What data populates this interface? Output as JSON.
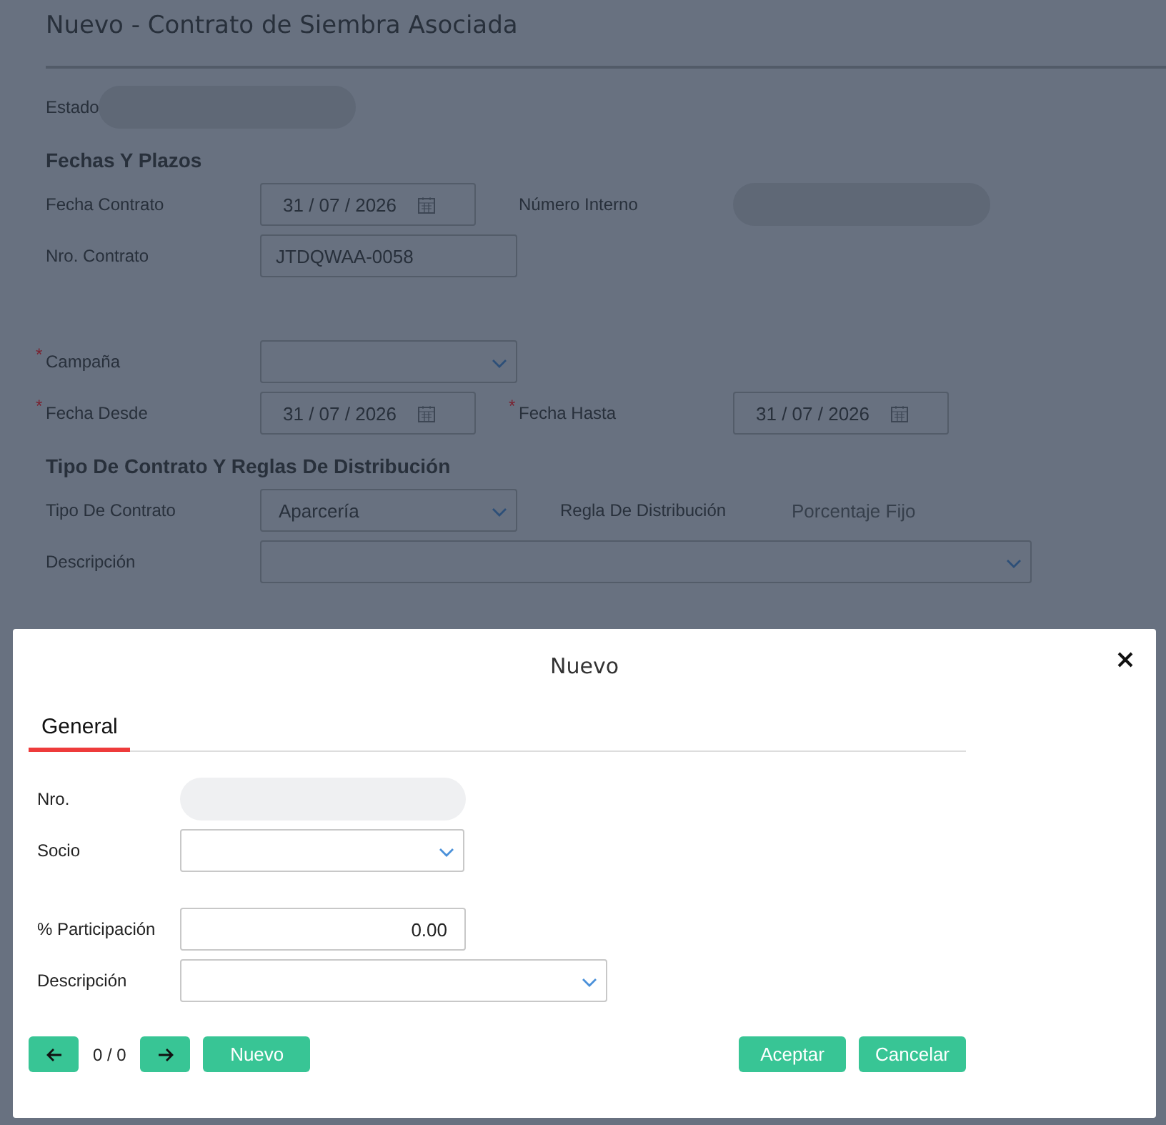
{
  "page": {
    "title": "Nuevo - Contrato de Siembra Asociada",
    "estado": {
      "label": "Estado"
    },
    "sections": [
      {
        "heading": "Fechas Y Plazos",
        "rows": [
          [
            {
              "kind": "date",
              "label": "Fecha Contrato",
              "value": "31 / 07 / 2026"
            },
            {
              "kind": "readonly",
              "label": "Número Interno"
            }
          ],
          [
            {
              "kind": "text",
              "label": "Nro. Contrato",
              "value": "JTDQWAA-0058"
            }
          ]
        ],
        "after_gap": [
          [
            {
              "kind": "select",
              "label": "Campaña",
              "required_mark": "*"
            }
          ],
          [
            {
              "kind": "date",
              "label": "Fecha Desde",
              "required_mark": "*",
              "value": "31 / 07 / 2026"
            },
            {
              "kind": "date",
              "label": "Fecha Hasta",
              "required_mark": "*",
              "value": "31 / 07 / 2026"
            }
          ]
        ]
      },
      {
        "heading": "Tipo De Contrato Y Reglas De Distribución",
        "rows": [
          [
            {
              "kind": "select",
              "label": "Tipo De Contrato",
              "value": "Aparcería"
            },
            {
              "kind": "plain",
              "label": "Regla De Distribución",
              "value": "Porcentaje Fijo"
            }
          ],
          [
            {
              "kind": "wideselect",
              "label": "Descripción"
            }
          ]
        ]
      }
    ]
  },
  "dialog": {
    "title": "Nuevo",
    "tabs": [
      {
        "label": "General",
        "selected": true
      }
    ],
    "fields": [
      {
        "kind": "readonly",
        "label": "Nro."
      },
      {
        "kind": "select",
        "label": "Socio"
      },
      {
        "kind": "number",
        "label": "% Participación",
        "value": "0.00"
      },
      {
        "kind": "wideselect",
        "label": "Descripción"
      }
    ],
    "counter": "0 / 0",
    "buttons": {
      "new": "Nuevo",
      "accept": "Aceptar",
      "cancel": "Cancelar"
    }
  }
}
